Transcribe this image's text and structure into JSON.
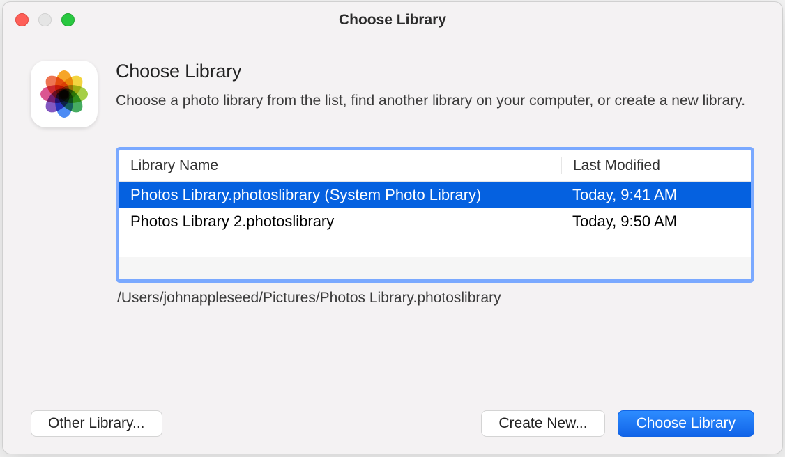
{
  "window": {
    "title": "Choose Library"
  },
  "header": {
    "title": "Choose Library",
    "description": "Choose a photo library from the list, find another library on your computer, or create a new library."
  },
  "table": {
    "columns": {
      "name": "Library Name",
      "modified": "Last Modified"
    },
    "rows": [
      {
        "name": "Photos Library.photoslibrary (System Photo Library)",
        "modified": "Today, 9:41 AM",
        "selected": true
      },
      {
        "name": "Photos Library 2.photoslibrary",
        "modified": "Today, 9:50 AM",
        "selected": false
      }
    ]
  },
  "path": "/Users/johnappleseed/Pictures/Photos Library.photoslibrary",
  "buttons": {
    "other": "Other Library...",
    "create": "Create New...",
    "choose": "Choose Library"
  }
}
